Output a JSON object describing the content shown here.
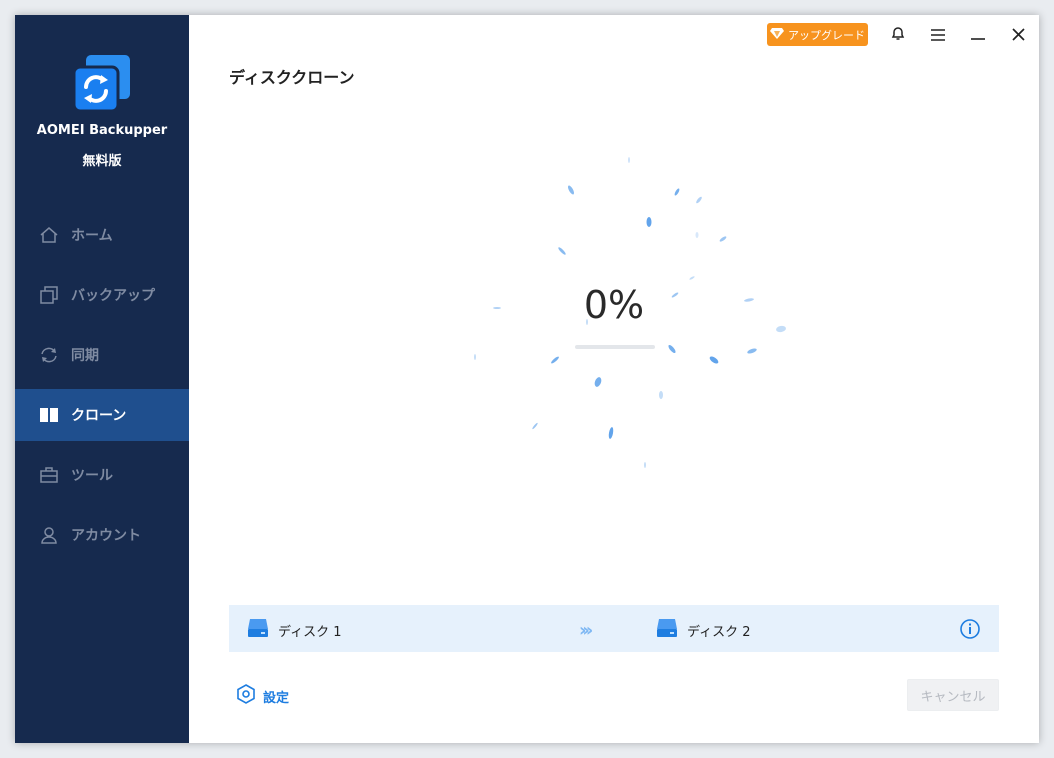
{
  "app": {
    "name": "AOMEI Backupper",
    "edition": "無料版"
  },
  "sidebar": {
    "items": [
      {
        "label": "ホーム",
        "icon": "home-icon",
        "active": false
      },
      {
        "label": "バックアップ",
        "icon": "backup-icon",
        "active": false
      },
      {
        "label": "同期",
        "icon": "sync-icon",
        "active": false
      },
      {
        "label": "クローン",
        "icon": "clone-icon",
        "active": true
      },
      {
        "label": "ツール",
        "icon": "tools-icon",
        "active": false
      },
      {
        "label": "アカウント",
        "icon": "account-icon",
        "active": false
      }
    ]
  },
  "titlebar": {
    "upgrade_label": "アップグレード"
  },
  "main": {
    "title": "ディスククローン",
    "progress": {
      "percent_text": "0%",
      "value": 0
    },
    "source_disk": "ディスク 1",
    "target_disk": "ディスク 2",
    "settings_label": "設定",
    "cancel_label": "キャンセル"
  },
  "colors": {
    "sidebar_bg": "#162a4e",
    "active_item_bg": "#1f4f8e",
    "accent": "#1e7de0",
    "upgrade": "#f7931e"
  }
}
